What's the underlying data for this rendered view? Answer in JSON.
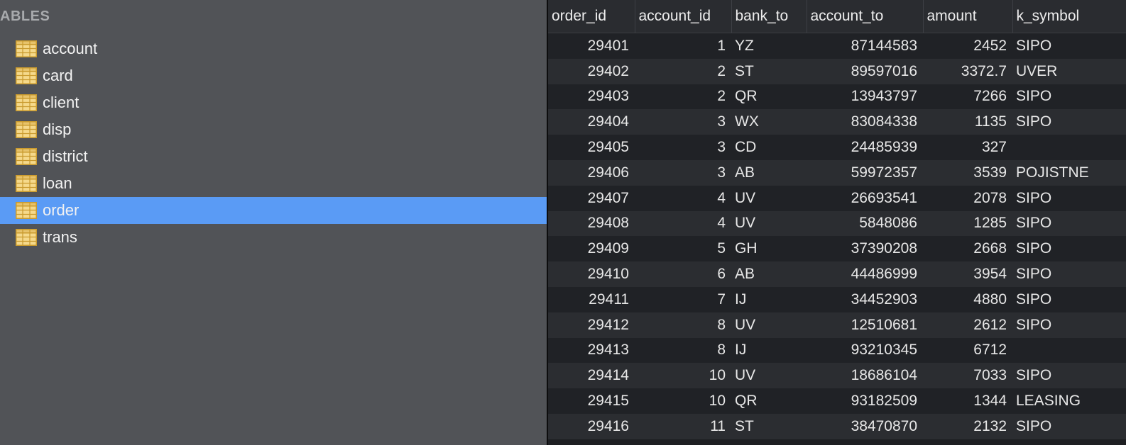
{
  "sidebar": {
    "header": "ABLES",
    "selected_index": 6,
    "items": [
      {
        "label": "account"
      },
      {
        "label": "card"
      },
      {
        "label": "client"
      },
      {
        "label": "disp"
      },
      {
        "label": "district"
      },
      {
        "label": "loan"
      },
      {
        "label": "order"
      },
      {
        "label": "trans"
      }
    ]
  },
  "grid": {
    "columns": [
      "order_id",
      "account_id",
      "bank_to",
      "account_to",
      "amount",
      "k_symbol"
    ],
    "rows": [
      [
        "29401",
        "1",
        "YZ",
        "87144583",
        "2452",
        "SIPO"
      ],
      [
        "29402",
        "2",
        "ST",
        "89597016",
        "3372.7",
        "UVER"
      ],
      [
        "29403",
        "2",
        "QR",
        "13943797",
        "7266",
        "SIPO"
      ],
      [
        "29404",
        "3",
        "WX",
        "83084338",
        "1135",
        "SIPO"
      ],
      [
        "29405",
        "3",
        "CD",
        "24485939",
        "327",
        ""
      ],
      [
        "29406",
        "3",
        "AB",
        "59972357",
        "3539",
        "POJISTNE"
      ],
      [
        "29407",
        "4",
        "UV",
        "26693541",
        "2078",
        "SIPO"
      ],
      [
        "29408",
        "4",
        "UV",
        "5848086",
        "1285",
        "SIPO"
      ],
      [
        "29409",
        "5",
        "GH",
        "37390208",
        "2668",
        "SIPO"
      ],
      [
        "29410",
        "6",
        "AB",
        "44486999",
        "3954",
        "SIPO"
      ],
      [
        "29411",
        "7",
        "IJ",
        "34452903",
        "4880",
        "SIPO"
      ],
      [
        "29412",
        "8",
        "UV",
        "12510681",
        "2612",
        "SIPO"
      ],
      [
        "29413",
        "8",
        "IJ",
        "93210345",
        "6712",
        ""
      ],
      [
        "29414",
        "10",
        "UV",
        "18686104",
        "7033",
        "SIPO"
      ],
      [
        "29415",
        "10",
        "QR",
        "93182509",
        "1344",
        "LEASING"
      ],
      [
        "29416",
        "11",
        "ST",
        "38470870",
        "2132",
        "SIPO"
      ]
    ]
  },
  "colors": {
    "sidebar_bg": "#515357",
    "selection": "#5a9bf5",
    "grid_bg": "#1e1f22",
    "icon_fill": "#f5d98b",
    "icon_stroke": "#c99a2e"
  },
  "icons": {
    "table": "table-grid-icon"
  }
}
